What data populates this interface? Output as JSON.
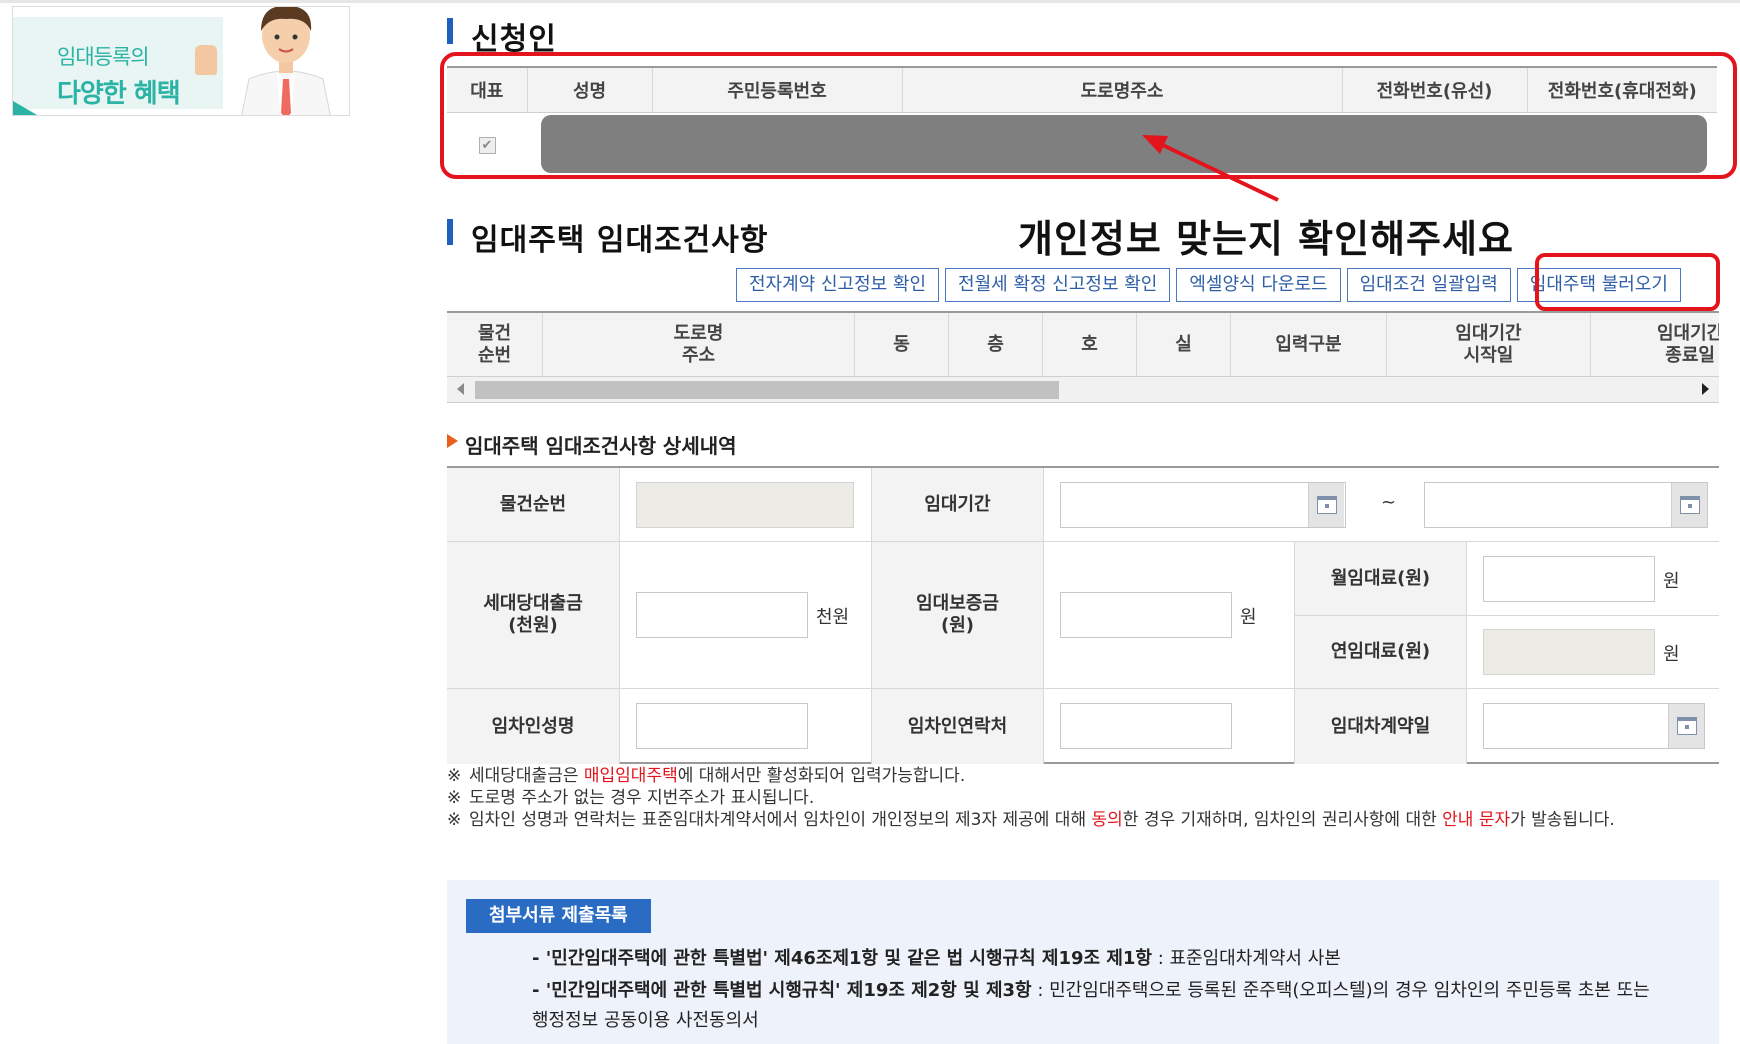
{
  "banner": {
    "line1": "임대등록의",
    "line2": "다양한 혜택"
  },
  "applicant": {
    "title": "신청인",
    "columns": [
      "대표",
      "성명",
      "주민등록번호",
      "도로명주소",
      "전화번호(유선)",
      "전화번호(휴대전화)"
    ],
    "row": {
      "rep_checked": "✔"
    }
  },
  "annotation": {
    "text": "개인정보 맞는지 확인해주세요"
  },
  "rental": {
    "title": "임대주택 임대조건사항",
    "buttons": [
      "전자계약 신고정보 확인",
      "전월세 확정 신고정보 확인",
      "엑셀양식 다운로드",
      "임대조건 일괄입력",
      "임대주택 불러오기"
    ],
    "columns": [
      "물건\n순번",
      "도로명\n주소",
      "동",
      "층",
      "호",
      "실",
      "입력구분",
      "임대기간\n시작일",
      "임대기간\n종료일"
    ]
  },
  "detail": {
    "title": "임대주택 임대조건사항 상세내역",
    "labels": {
      "item_no": "물건순번",
      "period": "임대기간",
      "household_loan": "세대당대출금\n(천원)",
      "deposit": "임대보증금\n(원)",
      "monthly_rent": "월임대료(원)",
      "annual_rent": "연임대료(원)",
      "tenant_name": "임차인성명",
      "tenant_contact": "임차인연락처",
      "contract_date": "임대차계약일"
    },
    "units": {
      "thousand_won": "천원",
      "won": "원",
      "tilde": "~"
    },
    "values": {
      "item_no": "",
      "period_start": "",
      "period_end": "",
      "household_loan": "",
      "deposit": "",
      "monthly_rent": "",
      "annual_rent": "",
      "tenant_name": "",
      "tenant_contact": "",
      "contract_date": ""
    }
  },
  "notes": {
    "mark": "※",
    "n1_a": "세대당대출금은 ",
    "n1_red": "매입임대주택",
    "n1_b": "에 대해서만 활성화되어 입력가능합니다.",
    "n2": "도로명 주소가 없는 경우 지번주소가 표시됩니다.",
    "n3_a": "임차인 성명과 연락처는 표준임대차계약서에서 임차인이 개인정보의 제3자 제공에 대해 ",
    "n3_red1": "동의",
    "n3_b": "한 경우 기재하며, 임차인의 권리사항에 대한 ",
    "n3_red2": "안내 문자",
    "n3_c": "가 발송됩니다."
  },
  "attachments": {
    "tag": "첨부서류 제출목록",
    "i1_bold": "- '민간임대주택에 관한 특별법' 제46조제1항 및 같은 법 시행규칙 제19조 제1항",
    "i1_rest": " : 표준임대차계약서 사본",
    "i2_bold": "- '민간임대주택에 관한 특별법 시행규칙' 제19조 제2항 및 제3항",
    "i2_rest": " : 민간임대주택으로 등록된 준주택(오피스텔)의 경우 임차인의 주민등록 초본 또는 행정정보 공동이용 사전동의서"
  },
  "colors": {
    "accent": "#1f5fbf",
    "highlight": "#e3141b",
    "teal": "#2bb3a6",
    "orange": "#e8601c"
  }
}
